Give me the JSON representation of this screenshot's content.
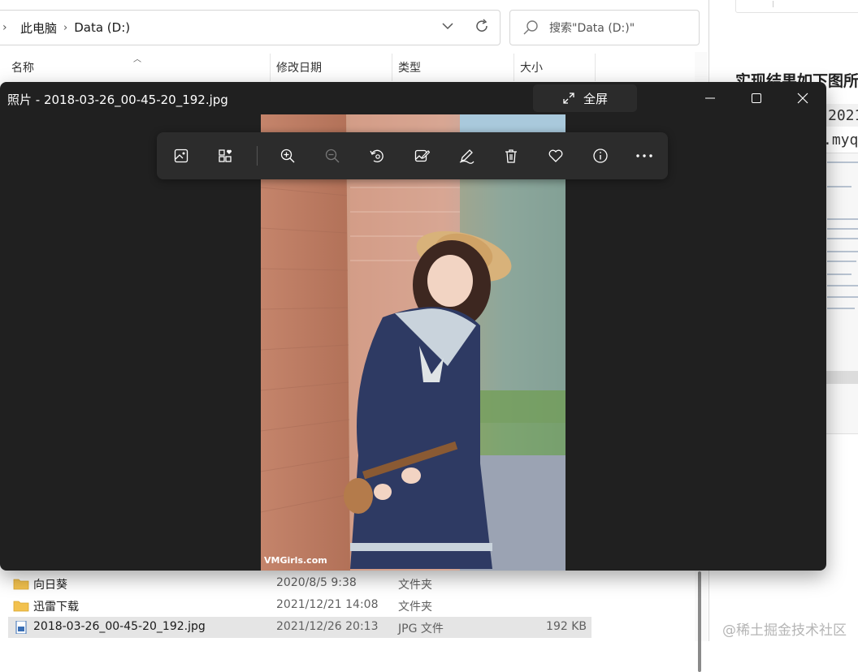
{
  "explorer": {
    "breadcrumb": [
      "此电脑",
      "Data (D:)"
    ],
    "search_placeholder": "搜索\"Data (D:)\"",
    "columns": [
      "名称",
      "修改日期",
      "类型",
      "大小"
    ],
    "rows": [
      {
        "name": "向日葵",
        "date": "2020/8/5 9:38",
        "type": "文件夹",
        "size": "",
        "icon": "folder-icon",
        "selected": false
      },
      {
        "name": "迅雷下载",
        "date": "2021/12/21 14:08",
        "type": "文件夹",
        "size": "",
        "icon": "folder-icon",
        "selected": false
      },
      {
        "name": "2018-03-26_00-45-20_192.jpg",
        "date": "2021/12/26 20:13",
        "type": "JPG 文件",
        "size": "192 KB",
        "icon": "image-file-icon",
        "selected": true
      }
    ]
  },
  "viewer": {
    "title": "照片 - 2018-03-26_00-45-20_192.jpg",
    "fullscreen_label": "全屏",
    "photo_watermark": "VMGirls.com",
    "toolbar_icons": [
      "view-all-photos-icon",
      "add-to-album-icon",
      "zoom-in-icon",
      "zoom-out-icon",
      "rotate-icon",
      "edit-image-icon",
      "draw-icon",
      "delete-icon",
      "favorite-icon",
      "info-icon",
      "more-icon"
    ],
    "window_controls": [
      "minimize-icon",
      "maximize-icon",
      "close-icon"
    ]
  },
  "article": {
    "heading": "实现结果如下图所",
    "code_line_1": "2021",
    "code_line_2": ".myq",
    "watermark": "@稀土掘金技术社区"
  },
  "colors": {
    "viewer_bg": "#202020",
    "toolbar_bg": "#2c2c2c",
    "folder_yellow": "#f2c14e",
    "selection": "#e5e5e5"
  }
}
